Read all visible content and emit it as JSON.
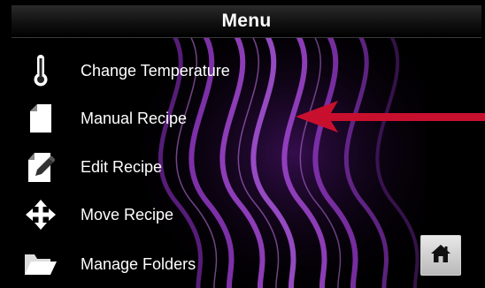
{
  "header": {
    "title": "Menu"
  },
  "menu": {
    "items": [
      {
        "label": "Change Temperature",
        "icon": "thermometer-icon"
      },
      {
        "label": "Manual Recipe",
        "icon": "document-icon"
      },
      {
        "label": "Edit Recipe",
        "icon": "edit-pencil-icon"
      },
      {
        "label": "Move Recipe",
        "icon": "move-arrows-icon"
      },
      {
        "label": "Manage Folders",
        "icon": "folder-icon"
      }
    ]
  },
  "home": {
    "icon": "home-icon"
  },
  "colors": {
    "background": "#000000",
    "wave": "#7b2fa8",
    "pointer_arrow": "#c8102e",
    "text": "#ffffff",
    "home_button": "#d4d4d4"
  }
}
